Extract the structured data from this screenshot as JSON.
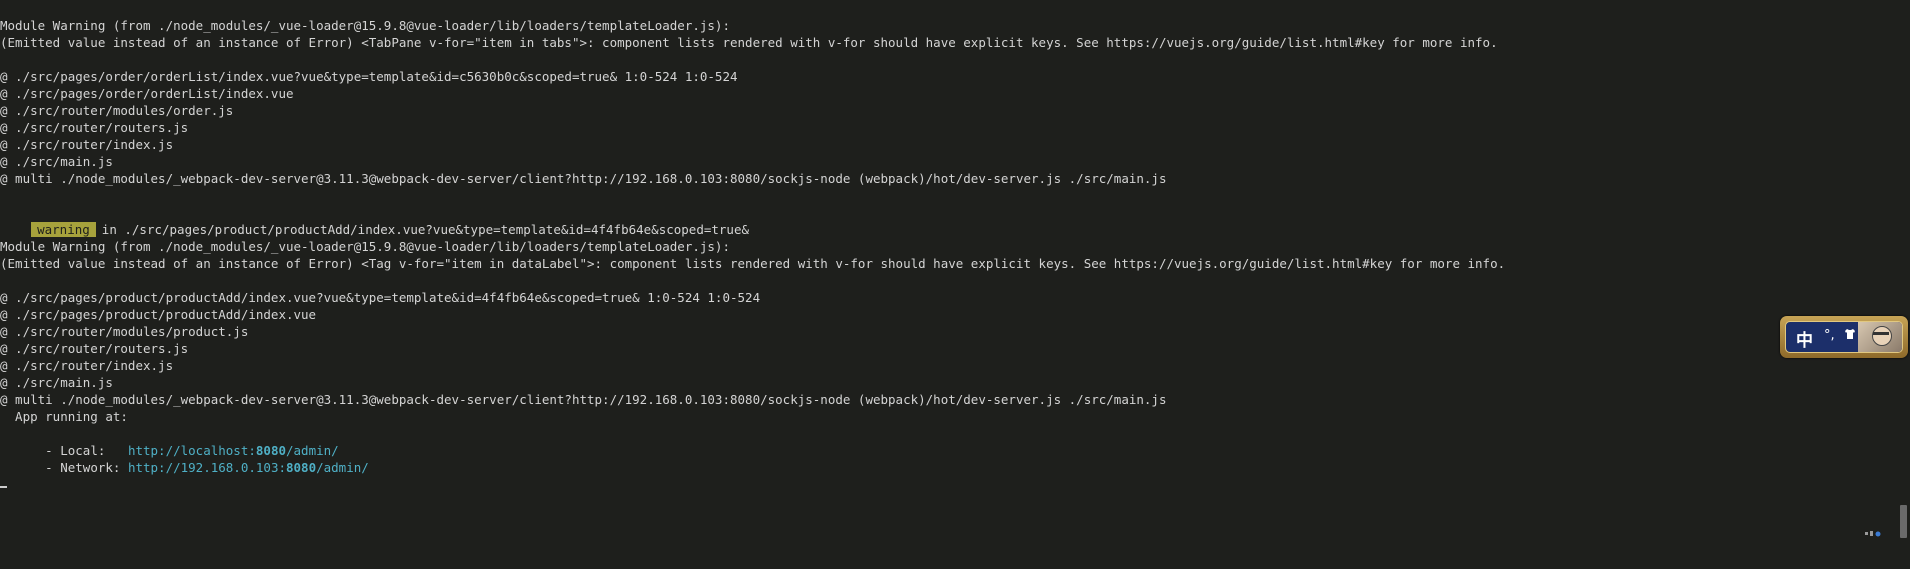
{
  "block1": {
    "header": "Module Warning (from ./node_modules/_vue-loader@15.9.8@vue-loader/lib/loaders/templateLoader.js):",
    "detail": "(Emitted value instead of an instance of Error) <TabPane v-for=\"item in tabs\">: component lists rendered with v-for should have explicit keys. See https://vuejs.org/guide/list.html#key for more info.",
    "trace": [
      "@ ./src/pages/order/orderList/index.vue?vue&type=template&id=c5630b0c&scoped=true& 1:0-524 1:0-524",
      "@ ./src/pages/order/orderList/index.vue",
      "@ ./src/router/modules/order.js",
      "@ ./src/router/routers.js",
      "@ ./src/router/index.js",
      "@ ./src/main.js",
      "@ multi ./node_modules/_webpack-dev-server@3.11.3@webpack-dev-server/client?http://192.168.0.103:8080/sockjs-node (webpack)/hot/dev-server.js ./src/main.js"
    ]
  },
  "warning_line": {
    "badge": "warning",
    "text": "in ./src/pages/product/productAdd/index.vue?vue&type=template&id=4f4fb64e&scoped=true&"
  },
  "block2": {
    "header": "Module Warning (from ./node_modules/_vue-loader@15.9.8@vue-loader/lib/loaders/templateLoader.js):",
    "detail": "(Emitted value instead of an instance of Error) <Tag v-for=\"item in dataLabel\">: component lists rendered with v-for should have explicit keys. See https://vuejs.org/guide/list.html#key for more info.",
    "trace": [
      "@ ./src/pages/product/productAdd/index.vue?vue&type=template&id=4f4fb64e&scoped=true& 1:0-524 1:0-524",
      "@ ./src/pages/product/productAdd/index.vue",
      "@ ./src/router/modules/product.js",
      "@ ./src/router/routers.js",
      "@ ./src/router/index.js",
      "@ ./src/main.js",
      "@ multi ./node_modules/_webpack-dev-server@3.11.3@webpack-dev-server/client?http://192.168.0.103:8080/sockjs-node (webpack)/hot/dev-server.js ./src/main.js"
    ]
  },
  "app_running": {
    "title": "  App running at:",
    "local_label": "  - Local:   ",
    "local_url_prefix": "http://localhost:",
    "local_port": "8080",
    "local_url_suffix": "/admin/",
    "network_label": "  - Network: ",
    "network_url_prefix": "http://192.168.0.103:",
    "network_port": "8080",
    "network_url_suffix": "/admin/"
  },
  "cursor": "_",
  "ime": {
    "mode_char": "中",
    "punct": "°,",
    "skin_icon": "shirt-icon"
  },
  "colors": {
    "background": "#1e1f1c",
    "text": "#d4d4d4",
    "warning_badge": "#a7a23c",
    "url": "#4fb0c6"
  }
}
